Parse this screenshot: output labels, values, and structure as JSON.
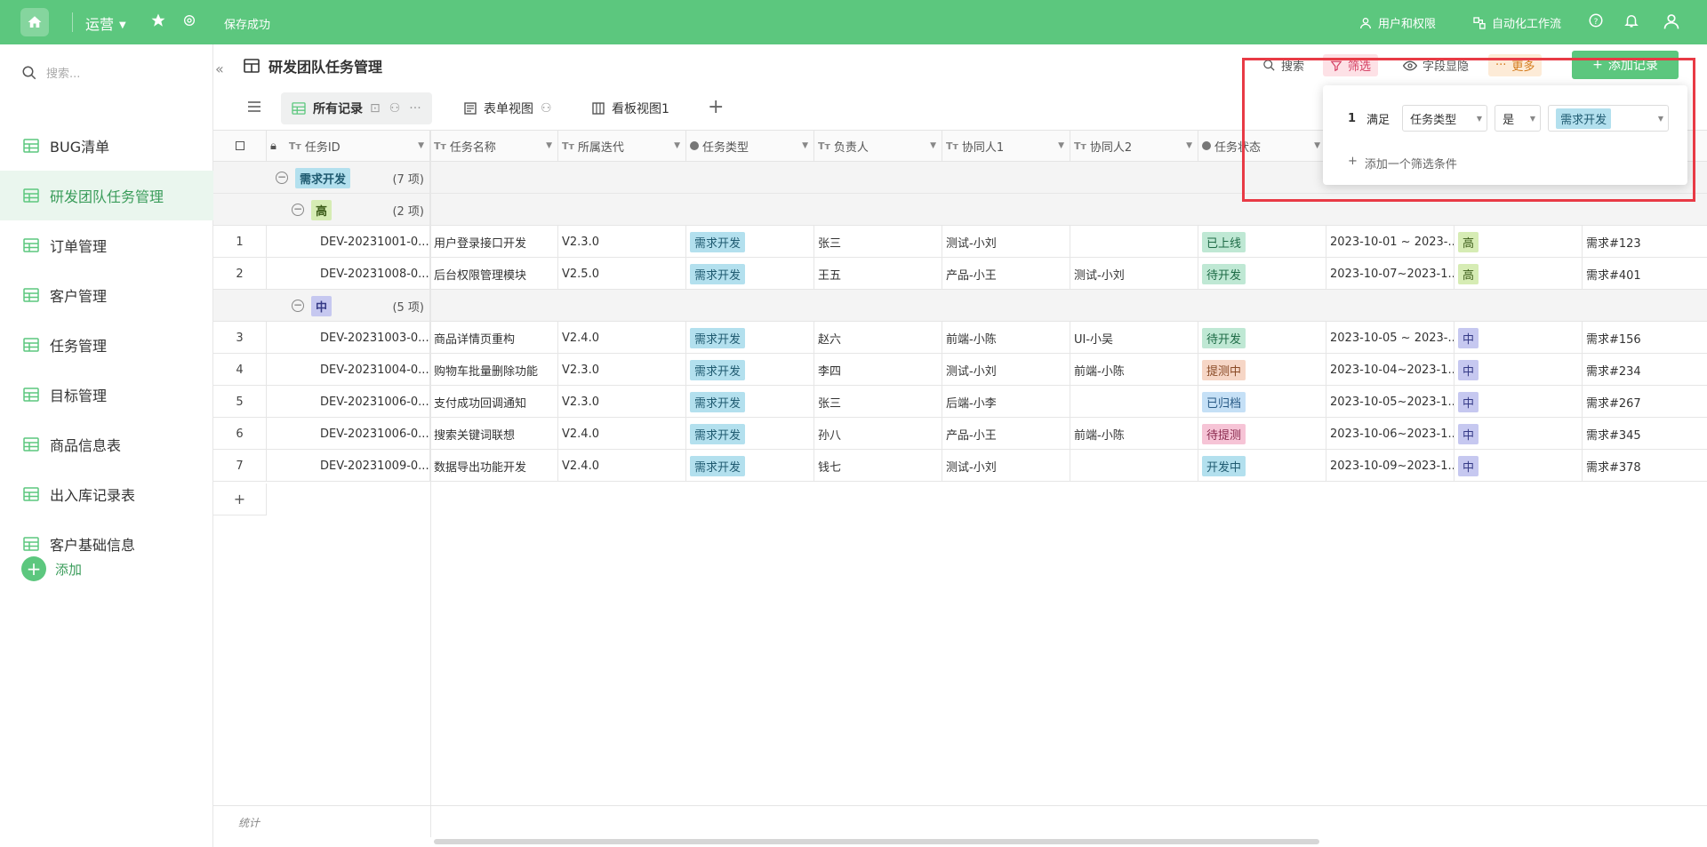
{
  "topbar": {
    "workspace": "运营",
    "save_status": "保存成功",
    "user_perm": "用户和权限",
    "automation": "自动化工作流"
  },
  "sidebar": {
    "search_placeholder": "搜索...",
    "items": [
      "BUG清单",
      "研发团队任务管理",
      "订单管理",
      "客户管理",
      "任务管理",
      "目标管理",
      "商品信息表",
      "出入库记录表",
      "客户基础信息"
    ],
    "active_index": 1,
    "add_label": "添加"
  },
  "page": {
    "title": "研发团队任务管理",
    "toolbar": {
      "search": "搜索",
      "filter": "筛选",
      "fields": "字段显隐",
      "more": "更多",
      "add_record": "添加记录"
    }
  },
  "views": {
    "tabs": [
      "所有记录",
      "表单视图",
      "看板视图1"
    ],
    "active": 0
  },
  "columns": [
    "任务ID",
    "任务名称",
    "所属迭代",
    "任务类型",
    "负责人",
    "协同人1",
    "协同人2",
    "任务状态"
  ],
  "groups": {
    "level1": {
      "label": "需求开发",
      "count": "(7 项)"
    },
    "high": {
      "label": "高",
      "count": "(2 项)"
    },
    "mid": {
      "label": "中",
      "count": "(5 项)"
    }
  },
  "rows": [
    {
      "n": "1",
      "id": "DEV-20231001-0...",
      "name": "用户登录接口开发",
      "iter": "V2.3.0",
      "type": "需求开发",
      "owner": "张三",
      "co1": "测试-小刘",
      "co2": "",
      "status": "已上线",
      "date": "2023-10-01 ~ 2023-...",
      "pri": "高",
      "req": "需求#123"
    },
    {
      "n": "2",
      "id": "DEV-20231008-0...",
      "name": "后台权限管理模块",
      "iter": "V2.5.0",
      "type": "需求开发",
      "owner": "王五",
      "co1": "产品-小王",
      "co2": "测试-小刘",
      "status": "待开发",
      "date": "2023-10-07~2023-1...",
      "pri": "高",
      "req": "需求#401"
    },
    {
      "n": "3",
      "id": "DEV-20231003-0...",
      "name": "商品详情页重构",
      "iter": "V2.4.0",
      "type": "需求开发",
      "owner": "赵六",
      "co1": "前端-小陈",
      "co2": "UI-小吴",
      "status": "待开发",
      "date": "2023-10-05 ~ 2023-...",
      "pri": "中",
      "req": "需求#156"
    },
    {
      "n": "4",
      "id": "DEV-20231004-0...",
      "name": "购物车批量删除功能",
      "iter": "V2.3.0",
      "type": "需求开发",
      "owner": "李四",
      "co1": "测试-小刘",
      "co2": "前端-小陈",
      "status": "提测中",
      "date": "2023-10-04~2023-1...",
      "pri": "中",
      "req": "需求#234"
    },
    {
      "n": "5",
      "id": "DEV-20231006-0...",
      "name": "支付成功回调通知",
      "iter": "V2.3.0",
      "type": "需求开发",
      "owner": "张三",
      "co1": "后端-小李",
      "co2": "",
      "status": "已归档",
      "date": "2023-10-05~2023-1...",
      "pri": "中",
      "req": "需求#267"
    },
    {
      "n": "6",
      "id": "DEV-20231006-0...",
      "name": "搜索关键词联想",
      "iter": "V2.4.0",
      "type": "需求开发",
      "owner": "孙八",
      "co1": "产品-小王",
      "co2": "前端-小陈",
      "status": "待提测",
      "date": "2023-10-06~2023-1...",
      "pri": "中",
      "req": "需求#345"
    },
    {
      "n": "7",
      "id": "DEV-20231009-0...",
      "name": "数据导出功能开发",
      "iter": "V2.4.0",
      "type": "需求开发",
      "owner": "钱七",
      "co1": "测试-小刘",
      "co2": "",
      "status": "开发中",
      "date": "2023-10-09~2023-1...",
      "pri": "中",
      "req": "需求#378"
    }
  ],
  "footer": {
    "stat": "统计",
    "add_row": "+"
  },
  "filter_popup": {
    "index": "1",
    "match": "满足",
    "field": "任务类型",
    "op": "是",
    "value": "需求开发",
    "add_condition": "添加一个筛选条件"
  },
  "colors": {
    "brand": "#5cc77e",
    "highlight": "#e83a45"
  }
}
